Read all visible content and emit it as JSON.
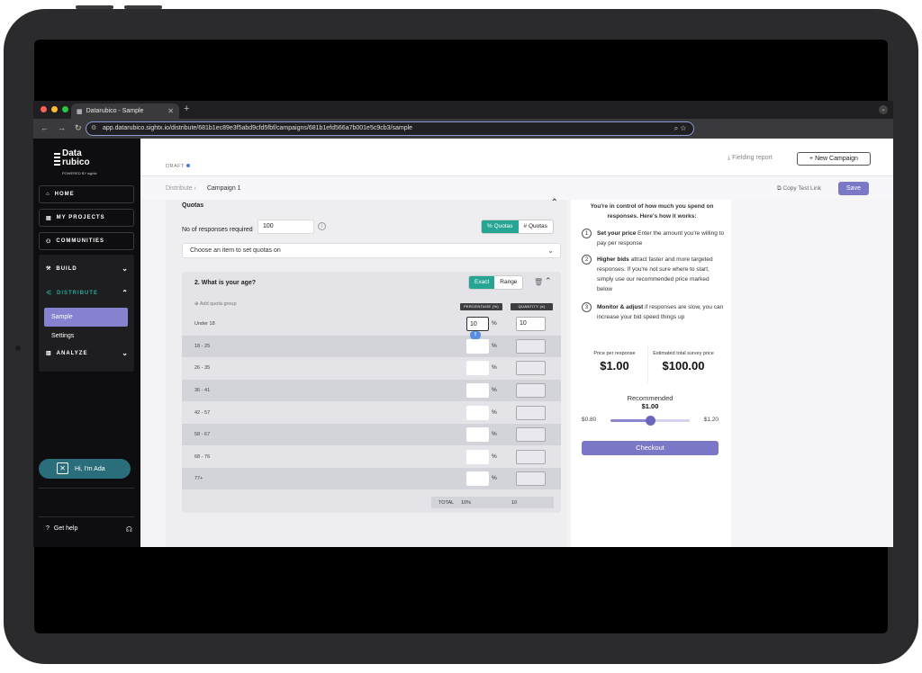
{
  "browser": {
    "tab_title": "Datarubico - Sample",
    "url": "app.datarubico.sightx.io/distribute/681b1ec89e3f5abd9cfd5fbf/campaigns/681b1efd566a7b001e5c9cb3/sample"
  },
  "sidebar": {
    "logo": {
      "line1": "Data",
      "line2": "rubico",
      "powered": "POWERED BY sightx"
    },
    "home": "HOME",
    "projects": "MY PROJECTS",
    "communities": "COMMUNITIES",
    "build": "BUILD",
    "distribute": "DISTRIBUTE",
    "sample": "Sample",
    "settings": "Settings",
    "analyze": "ANALYZE",
    "ada": "Hi, I'm Ada",
    "help": "Get help"
  },
  "header": {
    "status": "DRAFT",
    "fielding_report": "Fielding report",
    "new_campaign": "New Campaign",
    "breadcrumb_root": "Distribute",
    "breadcrumb_current": "Campaign 1",
    "copy_test_link": "Copy Test Link",
    "save": "Save"
  },
  "quotas": {
    "title": "Quotas",
    "responses_label": "No of responses required",
    "responses_value": "100",
    "pct_toggle": "% Quotas",
    "num_toggle": "# Quotas",
    "choose_placeholder": "Choose an item to set quotas on",
    "question": "2. What is your age?",
    "exact": "Exact",
    "range": "Range",
    "add_group": "Add quota group",
    "col_pct": "PERCENTAGE (%)",
    "col_qty": "QUANTITY (#)",
    "rows": [
      {
        "label": "Under 18",
        "pct": "10",
        "qty": "10"
      },
      {
        "label": "18 - 25",
        "pct": "",
        "qty": ""
      },
      {
        "label": "26 - 35",
        "pct": "",
        "qty": ""
      },
      {
        "label": "36 - 41",
        "pct": "",
        "qty": ""
      },
      {
        "label": "42 - 57",
        "pct": "",
        "qty": ""
      },
      {
        "label": "58 - 67",
        "pct": "",
        "qty": ""
      },
      {
        "label": "68 - 76",
        "pct": "",
        "qty": ""
      },
      {
        "label": "77+",
        "pct": "",
        "qty": ""
      }
    ],
    "pct_sign": "%",
    "total_label": "TOTAL",
    "total_pct": "10%",
    "total_qty": "10"
  },
  "pricing": {
    "intro": "You're in control of how much you spend on responses. Here's how it works:",
    "steps": [
      {
        "num": "1",
        "title": "Set your price",
        "text": "Enter the amount you're willing to pay per response"
      },
      {
        "num": "2",
        "title": "Higher bids",
        "text": "attract faster and more targeted responses. If you're not sure where to start, simply use our recommended price marked below"
      },
      {
        "num": "3",
        "title": "Monitor & adjust",
        "text": "if responses are slow, you can increase your bid speed things up"
      }
    ],
    "price_label": "Price per response",
    "price_value": "$1.00",
    "total_label": "Estimated total survey price",
    "total_value": "$100.00",
    "recommended_label": "Recommended",
    "recommended_value": "$1.00",
    "slider_min": "$0.80",
    "slider_max": "$1.20",
    "slider_fraction": 0.5,
    "checkout": "Checkout"
  },
  "colors": {
    "accent": "#7c78c8",
    "teal": "#27a594"
  }
}
